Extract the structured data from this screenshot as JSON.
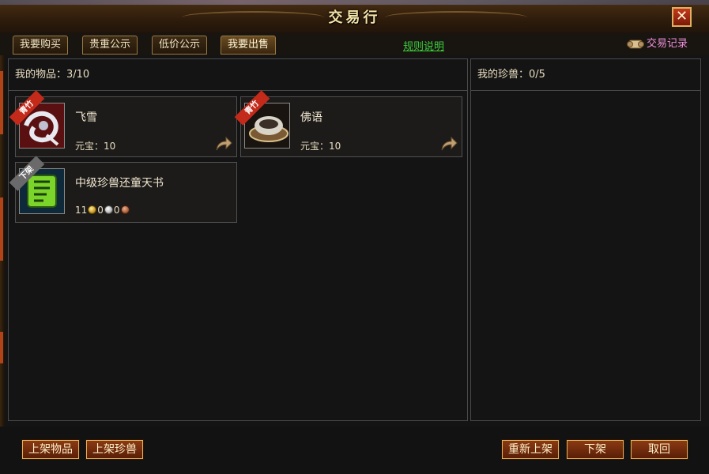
{
  "window": {
    "title": "交易行",
    "close_label": "✕"
  },
  "tabs": [
    {
      "label": "我要购买"
    },
    {
      "label": "贵重公示"
    },
    {
      "label": "低价公示"
    },
    {
      "label": "我要出售"
    }
  ],
  "rules_link": "规则说明",
  "records_label": "交易记录",
  "items_panel": {
    "header": "我的物品：3/10",
    "items": [
      {
        "name": "飞雪",
        "price_label": "元宝：",
        "price": "10",
        "badge": "青竹",
        "badge_color": "#c42a1a"
      },
      {
        "name": "佛语",
        "price_label": "元宝：",
        "price": "10",
        "badge": "青竹",
        "badge_color": "#c42a1a"
      },
      {
        "name": "中级珍兽还童天书",
        "gold": "11",
        "silver": "0",
        "copper": "0",
        "badge": "下架",
        "badge_color": "#6a6a6a"
      }
    ]
  },
  "pets_panel": {
    "header": "我的珍兽：0/5"
  },
  "buttons": {
    "list_item": "上架物品",
    "list_pet": "上架珍兽",
    "relist": "重新上架",
    "delist": "下架",
    "retrieve": "取回"
  }
}
